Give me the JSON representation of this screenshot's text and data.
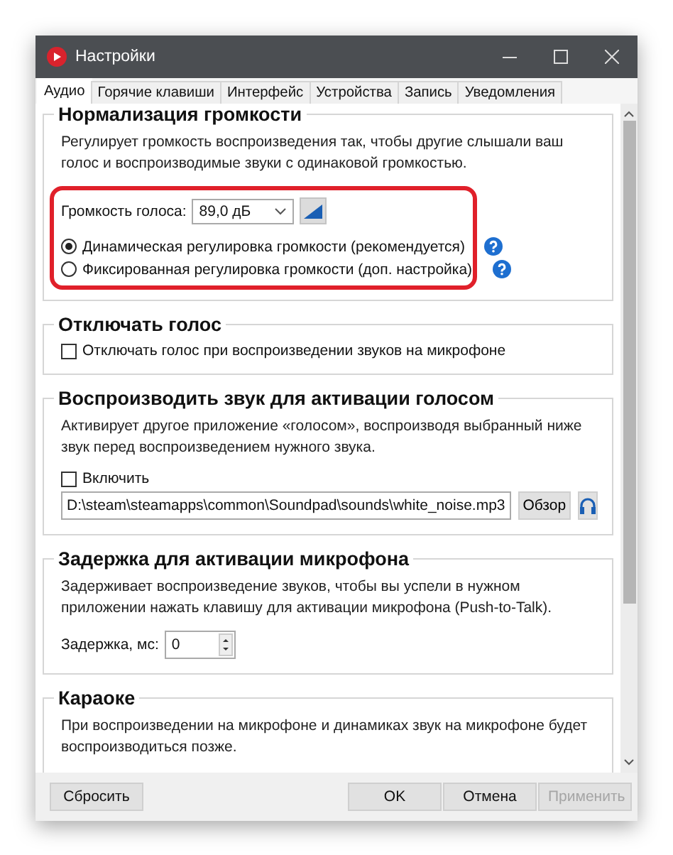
{
  "window": {
    "title": "Настройки"
  },
  "tabs": [
    {
      "label": "Аудио",
      "selected": true
    },
    {
      "label": "Горячие клавиши",
      "selected": false
    },
    {
      "label": "Интерфейс",
      "selected": false
    },
    {
      "label": "Устройства",
      "selected": false
    },
    {
      "label": "Запись",
      "selected": false
    },
    {
      "label": "Уведомления",
      "selected": false
    }
  ],
  "sections": [
    {
      "title": "Нормализация громкости",
      "highlight": true,
      "items": [
        {
          "kind": "text",
          "text": "Регулирует громкость воспроизведения так, чтобы другие слышали ваш голос и воспроизводимые звуки с одинаковой громкостью."
        },
        {
          "kind": "dropdown",
          "label": "Громкость голоса:",
          "value": "89,0 дБ"
        },
        {
          "kind": "radio",
          "label": "Динамическая регулировка громкости (рекомендуется)",
          "selected": true,
          "help": true
        },
        {
          "kind": "radio",
          "label": "Фиксированная регулировка громкости (доп. настройка)",
          "selected": false,
          "help": true
        }
      ]
    },
    {
      "title": "Отключать голос",
      "highlight": false,
      "items": [
        {
          "kind": "checkbox",
          "label": "Отключать голос при воспроизведении звуков на микрофоне",
          "checked": false
        }
      ]
    },
    {
      "title": "Воспроизводить звук для активации голосом",
      "highlight": false,
      "items": [
        {
          "kind": "text",
          "text": "Активирует другое приложение «голосом», воспроизводя выбранный ниже звук перед воспроизведением нужного звука."
        },
        {
          "kind": "checkbox",
          "label": "Включить",
          "checked": false
        },
        {
          "kind": "file",
          "value": "D:\\steam\\steamapps\\common\\Soundpad\\sounds\\white_noise.mp3",
          "button": "Обзор"
        }
      ]
    },
    {
      "title": "Задержка для активации микрофона",
      "highlight": false,
      "items": [
        {
          "kind": "text",
          "text": "Задерживает воспроизведение звуков, чтобы вы успели в нужном приложении нажать клавишу для активации микрофона (Push-to-Talk)."
        },
        {
          "kind": "spin",
          "label": "Задержка, мс:",
          "value": "0"
        }
      ]
    },
    {
      "title": "Караоке",
      "highlight": false,
      "items": [
        {
          "kind": "text",
          "text": "При воспроизведении на микрофоне и динамиках звук на микрофоне будет воспроизводиться позже."
        }
      ]
    }
  ],
  "buttons": [
    {
      "label": "Сбросить",
      "disabled": false
    },
    {
      "label": "OK",
      "disabled": false
    },
    {
      "label": "Отмена",
      "disabled": false
    },
    {
      "label": "Применить",
      "disabled": true
    }
  ]
}
